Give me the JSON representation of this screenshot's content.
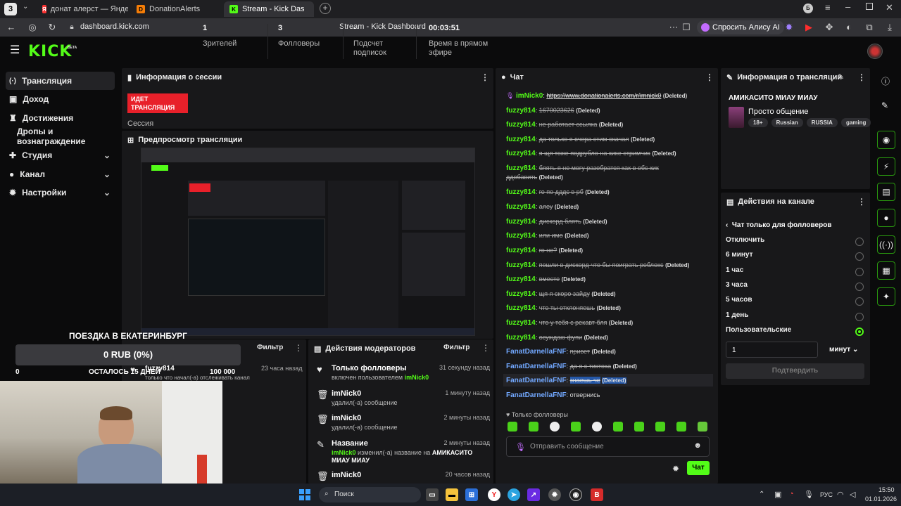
{
  "browser": {
    "tab_count_badge": "3",
    "tabs": [
      {
        "label": "донат алерст — Яндекс: н"
      },
      {
        "label": "DonationAlerts"
      },
      {
        "label": "Stream - Kick Dashboard"
      }
    ],
    "url": "dashboard.kick.com",
    "page_title": "Stream - Kick Dashboard",
    "alice_label": "Спросить Алису AI"
  },
  "brand": {
    "logo": "KICK",
    "beta": "BETA"
  },
  "sidebar": {
    "items": [
      {
        "label": "Трансляция"
      },
      {
        "label": "Доход"
      },
      {
        "label": "Достижения"
      },
      {
        "label": "Дропы и вознаграждение"
      },
      {
        "label": "Студия"
      },
      {
        "label": "Канал"
      },
      {
        "label": "Настройки"
      }
    ]
  },
  "session": {
    "title": "Информация о сессии",
    "live_badge": "ИДЕТ ТРАНСЛЯЦИЯ",
    "session_label": "Сессия",
    "viewers_value": "1",
    "viewers_label": "Зрителей",
    "followers_value": "3",
    "followers_label": "Фолловеры",
    "subs_value": "-",
    "subs_label": "Подсчет подписок",
    "time_value": "00:03:51",
    "time_label": "Время в прямом эфире"
  },
  "preview": {
    "title": "Предпросмотр трансляции"
  },
  "overlay": {
    "goal_title": "ПОЕЗДКА В ЕКАТЕРИНБУРГ",
    "goal_amount": "0 RUB (0%)",
    "goal_left": "0",
    "goal_days": "ОСТАЛОСЬ 15 ДНЕЙ",
    "goal_right": "100 000"
  },
  "activity": {
    "filter_label": "Фильтр",
    "item_name": "fuzzy814",
    "item_time": "23 часа назад",
    "item_desc": "только что начал(-а) отслеживать канал"
  },
  "mod_actions": {
    "title": "Действия модераторов",
    "filter_label": "Фильтр",
    "items": [
      {
        "name": "Только фолловеры",
        "time": "31 секунду назад",
        "desc": "включен пользователем",
        "actor": "imNick0"
      },
      {
        "name": "imNick0",
        "time": "1 минуту назад",
        "desc": "удалил(-а) сообщение"
      },
      {
        "name": "imNick0",
        "time": "2 минуты назад",
        "desc": "удалил(-а) сообщение"
      },
      {
        "name": "Название",
        "time": "2 минуты назад",
        "actor": "imNick0",
        "desc": "изменил(-а) название на",
        "new_title": "АМИКАСИТО МИАУ МИАУ"
      },
      {
        "name": "imNick0",
        "time": "20 часов назад"
      }
    ]
  },
  "chat": {
    "title": "Чат",
    "deleted_tag": "(Deleted)",
    "messages": [
      {
        "user": "imNick0",
        "text": "https://www.donationalerts.com/r/imnick0"
      },
      {
        "user": "fuzzy814",
        "text": "1670023626"
      },
      {
        "user": "fuzzy814",
        "text": "не работает ссылка"
      },
      {
        "user": "fuzzy814",
        "text": "да только я вчера стим скачал"
      },
      {
        "user": "fuzzy814",
        "text": "я щя тоже подрубло на кике стримчик"
      },
      {
        "user": "fuzzy814",
        "text": "блять я не могу разобратся как в обс кик",
        "text2": "ддобавить"
      },
      {
        "user": "fuzzy814",
        "text": "го по дддс в рб"
      },
      {
        "user": "fuzzy814",
        "text": "алеу"
      },
      {
        "user": "fuzzy814",
        "text": "дискорд блять"
      },
      {
        "user": "fuzzy814",
        "text": "или имо"
      },
      {
        "user": "fuzzy814",
        "text": "го не?"
      },
      {
        "user": "fuzzy814",
        "text": "пошли в дискорд что бы поиграть роблокс"
      },
      {
        "user": "fuzzy814",
        "text": "вместе"
      },
      {
        "user": "fuzzy814",
        "text": "щя я скоро зайду"
      },
      {
        "user": "fuzzy814",
        "text": "что ты отклоняешь"
      },
      {
        "user": "fuzzy814",
        "text": "что у тебя с рекавт бля"
      },
      {
        "user": "fuzzy814",
        "text": "осуждаю фупи"
      },
      {
        "user": "FanatDarnellaFNF",
        "text": "привет"
      },
      {
        "user": "FanatDarnellaFNF",
        "text": "да я с тиктока"
      },
      {
        "user": "FanatDarnellaFNF",
        "text": "знаешь че"
      },
      {
        "user": "FanatDarnellaFNF",
        "text": "отвернись"
      }
    ],
    "followers_only": "Только фолловеры",
    "input_placeholder": "Отправить сообщение",
    "send_label": "Чат"
  },
  "stream_info": {
    "title": "Информация о трансляции",
    "stream_title": "АМИКАСИТО МИАУ МИАУ",
    "category": "Просто общение",
    "tags": [
      "18+",
      "Russian",
      "RUSSIA",
      "gaming"
    ]
  },
  "channel_actions": {
    "title": "Действия на канале",
    "back_label": "Чат только для фолловеров",
    "options": [
      "Отключить",
      "6 минут",
      "1 час",
      "3 часа",
      "5 часов",
      "1 день",
      "Пользовательские"
    ],
    "custom_value": "1",
    "unit_label": "минут",
    "confirm_label": "Подтвердить"
  },
  "taskbar": {
    "search_label": "Поиск",
    "lang": "РУС",
    "time": "15:50",
    "date": "01.01.2026"
  },
  "colors": {
    "accent": "#53fc18",
    "live": "#e8202a",
    "bg": "#0b0b0c",
    "panel": "#18181a"
  }
}
